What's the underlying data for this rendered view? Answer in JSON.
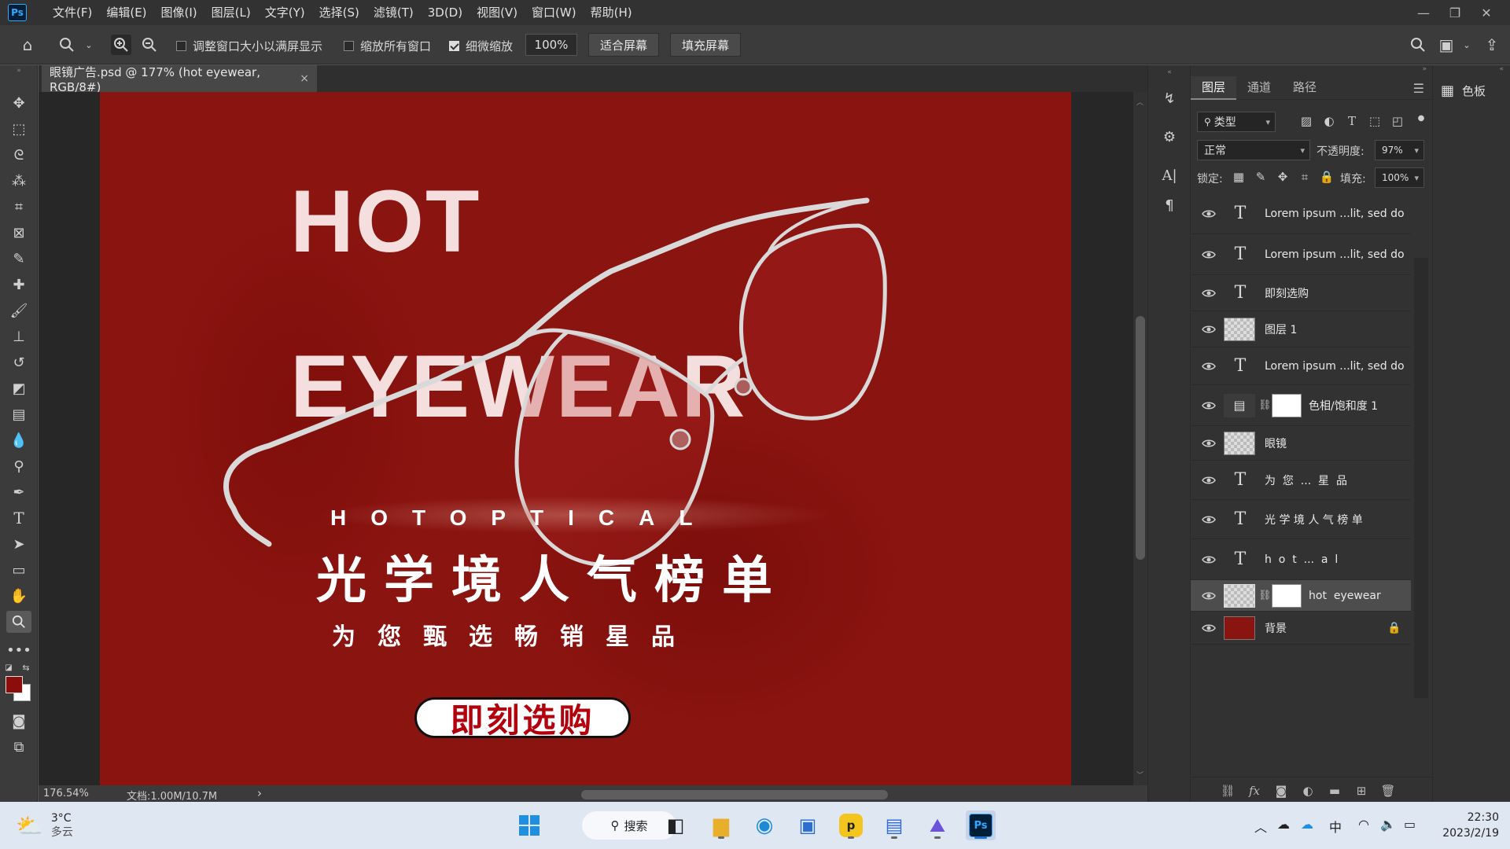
{
  "menubar": {
    "logo": "Ps",
    "items": [
      "文件(F)",
      "编辑(E)",
      "图像(I)",
      "图层(L)",
      "文字(Y)",
      "选择(S)",
      "滤镜(T)",
      "3D(D)",
      "视图(V)",
      "窗口(W)",
      "帮助(H)"
    ]
  },
  "options": {
    "resize_windows_label": "调整窗口大小以满屏显示",
    "zoom_all_label": "缩放所有窗口",
    "scrubby_label": "细微缩放",
    "zoom_value": "100%",
    "fit_screen_label": "适合屏幕",
    "fill_screen_label": "填充屏幕"
  },
  "document": {
    "tab_title": "眼镜广告.psd @ 177% (hot  eyewear, RGB/8#)",
    "close_glyph": "×"
  },
  "artwork": {
    "hot": "HOT",
    "eyewear": "EYEWEAR",
    "optical": "HOTOPTICAL",
    "cn_title": "光学境人气榜单",
    "cn_sub": "为您甄选畅销星品",
    "buy_now": "即刻选购"
  },
  "status": {
    "zoom": "176.54%",
    "doc_size": "文档:1.00M/10.7M",
    "arrow": "›"
  },
  "layers_panel": {
    "tabs": [
      "图层",
      "通道",
      "路径"
    ],
    "filter_label": "类型",
    "blend_mode": "正常",
    "opacity_label": "不透明度:",
    "opacity_value": "97%",
    "lock_label": "锁定:",
    "fill_label": "填充:",
    "fill_value": "100%",
    "layers": [
      {
        "name": "Lorem ipsum ...lit, sed do",
        "kind": "text"
      },
      {
        "name": "Lorem ipsum ...lit, sed do",
        "kind": "text"
      },
      {
        "name": "即刻选购",
        "kind": "text"
      },
      {
        "name": "图层 1",
        "kind": "pixel"
      },
      {
        "name": "Lorem ipsum ...lit, sed do",
        "kind": "text"
      },
      {
        "name": "色相/饱和度 1",
        "kind": "adjustment"
      },
      {
        "name": "眼镜",
        "kind": "pixel"
      },
      {
        "name": "为  您  ...  星  品",
        "kind": "text"
      },
      {
        "name": "光 学 境 人 气 榜 单",
        "kind": "text"
      },
      {
        "name": "h  o  t  ...  a  l",
        "kind": "text"
      },
      {
        "name": "hot  eyewear",
        "kind": "masked",
        "selected": true
      },
      {
        "name": "背景",
        "kind": "background",
        "locked": true
      }
    ]
  },
  "swatches": {
    "label": "色板"
  },
  "taskbar": {
    "weather_temp": "3°C",
    "weather_desc": "多云",
    "search_label": "搜索",
    "ime": "中",
    "time": "22:30",
    "date": "2023/2/19"
  },
  "colors": {
    "foreground": "#8b0e0a",
    "background": "#ffffff",
    "artboard": "#8a1410",
    "ps_blue": "#31a8ff"
  }
}
